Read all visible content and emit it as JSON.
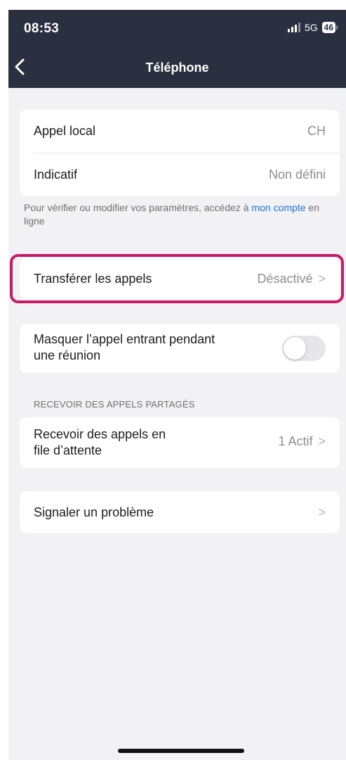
{
  "status_bar": {
    "time": "08:53",
    "network": "5G",
    "battery": "46"
  },
  "nav": {
    "title": "Téléphone"
  },
  "info_card": {
    "rows": [
      {
        "label": "Appel local",
        "value": "CH"
      },
      {
        "label": "Indicatif",
        "value": "Non défini"
      }
    ]
  },
  "helper": {
    "text_before": "Pour vérifier ou modifier vos paramètres, accédez à ",
    "link": "mon compte",
    "text_after": " en ligne"
  },
  "forward_row": {
    "label": "Transférer les appels",
    "value": "Désactivé"
  },
  "mask_row": {
    "label_line1": "Masquer l’appel entrant pendant",
    "label_line2": "une réunion",
    "toggle_on": false
  },
  "shared_section": {
    "header": "RECEVOIR DES APPELS PARTAGÉS",
    "row": {
      "label_line1": "Recevoir des appels en",
      "label_line2": "file d’attente",
      "value": "1 Actif"
    }
  },
  "report_row": {
    "label": "Signaler un problème"
  },
  "colors": {
    "header_bg": "#2b3040",
    "highlight": "#c8196b",
    "link": "#1a73d9",
    "page_bg": "#f2f2f4"
  }
}
